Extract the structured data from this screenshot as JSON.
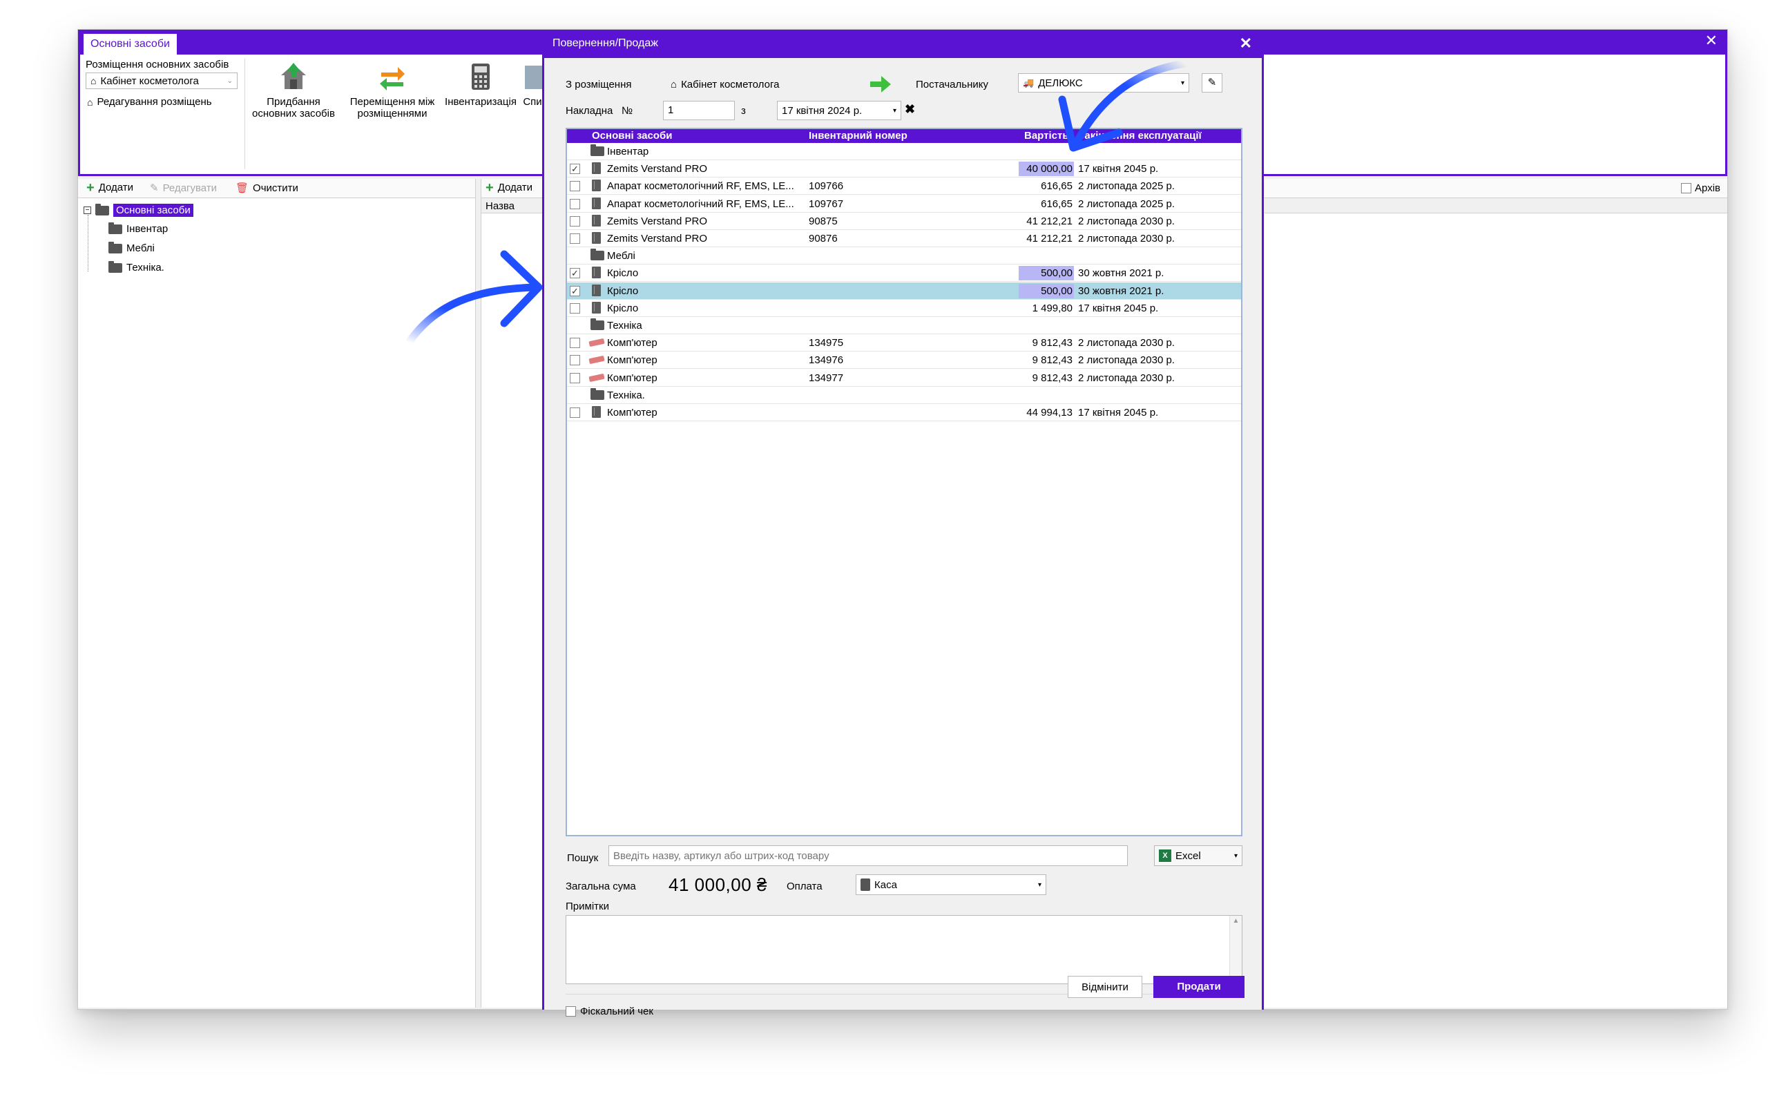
{
  "main_window": {
    "tab_title": "Основні засоби",
    "close_glyph": "✕",
    "ribbon": {
      "placement_group_label": "Розміщення основних засобів",
      "placement_select": "Кабінет косметолога",
      "edit_placements": "Редагування розміщень",
      "buttons": [
        {
          "line1": "Придбання",
          "line2": "основних засобів",
          "icon": "house-arrow-icon"
        },
        {
          "line1": "Переміщення між",
          "line2": "розміщеннями",
          "icon": "transfer-arrows-icon"
        },
        {
          "line1": "Інвентаризація",
          "line2": "",
          "icon": "calculator-icon"
        },
        {
          "line1": "Спи",
          "line2": "",
          "icon": "list-icon"
        }
      ]
    },
    "left_toolbar": {
      "add": "Додати",
      "edit": "Редагувати",
      "clear": "Очистити"
    },
    "tree": {
      "root": "Основні засоби",
      "children": [
        "Інвентар",
        "Меблі",
        "Техніка."
      ]
    },
    "mid_toolbar": {
      "add": "Додати",
      "column": "Назва"
    },
    "right_toolbar": {
      "archive": "Архів"
    }
  },
  "dialog": {
    "title": "Повернення/Продаж",
    "close_glyph": "✕",
    "from_label": "З розміщення",
    "from_value": "Кабінет косметолога",
    "to_label": "Постачальнику",
    "supplier_value": "ДЕЛЮКС",
    "invoice_label": "Накладна",
    "number_label": "№",
    "invoice_number": "1",
    "from_date_label": "з",
    "invoice_date": "17 квітня 2024 р.",
    "grid": {
      "headers": [
        "Основні засоби",
        "Інвентарний номер",
        "Вартість",
        "Закінчення експлуатації"
      ],
      "rows": [
        {
          "type": "group",
          "name": "Інвентар"
        },
        {
          "type": "item",
          "icon": "book",
          "checked": true,
          "name": "Zemits Verstand PRO",
          "inv": "",
          "cost": "40 000,00",
          "end": "17 квітня 2045 р.",
          "hl": true,
          "sel": false
        },
        {
          "type": "item",
          "icon": "book",
          "checked": false,
          "name": "Апарат косметологічний RF, EMS, LE...",
          "inv": "109766",
          "cost": "616,65",
          "end": "2 листопада 2025 р.",
          "hl": false,
          "sel": false
        },
        {
          "type": "item",
          "icon": "book",
          "checked": false,
          "name": "Апарат косметологічний RF, EMS, LE...",
          "inv": "109767",
          "cost": "616,65",
          "end": "2 листопада 2025 р.",
          "hl": false,
          "sel": false
        },
        {
          "type": "item",
          "icon": "book",
          "checked": false,
          "name": "Zemits Verstand PRO",
          "inv": "90875",
          "cost": "41 212,21",
          "end": "2 листопада 2030 р.",
          "hl": false,
          "sel": false
        },
        {
          "type": "item",
          "icon": "book",
          "checked": false,
          "name": "Zemits Verstand PRO",
          "inv": "90876",
          "cost": "41 212,21",
          "end": "2 листопада 2030 р.",
          "hl": false,
          "sel": false
        },
        {
          "type": "group",
          "name": "Меблі"
        },
        {
          "type": "item",
          "icon": "book",
          "checked": true,
          "name": "Крісло",
          "inv": "",
          "cost": "500,00",
          "end": "30 жовтня 2021 р.",
          "hl": true,
          "sel": false
        },
        {
          "type": "item",
          "icon": "book",
          "checked": true,
          "name": "Крісло",
          "inv": "",
          "cost": "500,00",
          "end": "30 жовтня 2021 р.",
          "hl": true,
          "sel": true
        },
        {
          "type": "item",
          "icon": "book",
          "checked": false,
          "name": "Крісло",
          "inv": "",
          "cost": "1 499,80",
          "end": "17 квітня 2045 р.",
          "hl": false,
          "sel": false
        },
        {
          "type": "group",
          "name": "Техніка"
        },
        {
          "type": "item",
          "icon": "pc",
          "checked": false,
          "name": "Комп'ютер",
          "inv": "134975",
          "cost": "9 812,43",
          "end": "2 листопада 2030 р.",
          "hl": false,
          "sel": false
        },
        {
          "type": "item",
          "icon": "pc",
          "checked": false,
          "name": "Комп'ютер",
          "inv": "134976",
          "cost": "9 812,43",
          "end": "2 листопада 2030 р.",
          "hl": false,
          "sel": false
        },
        {
          "type": "item",
          "icon": "pc",
          "checked": false,
          "name": "Комп'ютер",
          "inv": "134977",
          "cost": "9 812,43",
          "end": "2 листопада 2030 р.",
          "hl": false,
          "sel": false
        },
        {
          "type": "group",
          "name": "Техніка."
        },
        {
          "type": "item",
          "icon": "book",
          "checked": false,
          "name": "Комп'ютер",
          "inv": "",
          "cost": "44 994,13",
          "end": "17 квітня 2045 р.",
          "hl": false,
          "sel": false
        }
      ]
    },
    "search_label": "Пошук",
    "search_placeholder": "Введіть назву, артикул або штрих-код товару",
    "excel_button": "Excel",
    "total_label": "Загальна сума",
    "total_value": "41 000,00 ₴",
    "payment_label": "Оплата",
    "payment_value": "Каса",
    "notes_label": "Примітки",
    "fiscal_label": "Фіскальний чек",
    "cancel_button": "Відмінити",
    "sell_button": "Продати"
  },
  "colors": {
    "accent": "#5a12d3",
    "selected_row": "#add8e6",
    "cost_highlight": "#b9b6f6",
    "annotation_arrow": "#1f4fff"
  }
}
